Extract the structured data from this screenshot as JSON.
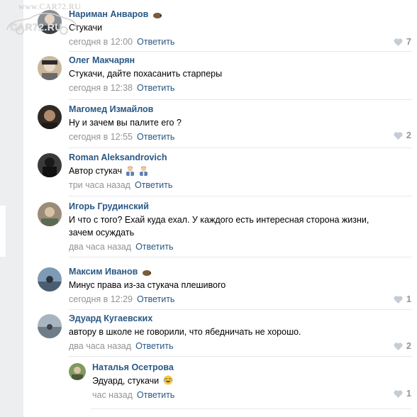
{
  "watermark": {
    "top": "www.CAR72.RU",
    "main": "CAR72.RU"
  },
  "comments": [
    {
      "author": "Нариман Анваров",
      "text": "Стукачи",
      "date": "сегодня в 12:00",
      "reply": "Ответить",
      "likes": "7",
      "badge": "hedgehog-icon"
    },
    {
      "author": "Олег Макчарян",
      "text": "Стукачи, дайте похасанить старперы",
      "date": "сегодня в 12:38",
      "reply": "Ответить",
      "likes": ""
    },
    {
      "author": "Магомед Измайлов",
      "text": "Ну и зачем вы палите его ?",
      "date": "сегодня в 12:55",
      "reply": "Ответить",
      "likes": "2"
    },
    {
      "author": "Roman Aleksandrovich",
      "text": "Автор стукач",
      "date": "три часа назад",
      "reply": "Ответить",
      "likes": "",
      "emoji": [
        "man-office-worker-emoji",
        "man-office-worker-emoji"
      ]
    },
    {
      "author": "Игорь Грудинский",
      "text_line1": "И что с того? Ехай куда ехал. У каждого есть интересная сторона жизни,",
      "text_line2": "зачем осуждать",
      "date": "два часа назад",
      "reply": "Ответить",
      "likes": ""
    },
    {
      "author": "Максим Иванов",
      "text": "Минус права из-за стукача плешивого",
      "date": "сегодня в 12:29",
      "reply": "Ответить",
      "likes": "1",
      "badge": "hedgehog-icon"
    },
    {
      "author": "Эдуард Кугаевских",
      "text": "автору в школе не говорили, что ябедничать не хорошо.",
      "date": "два часа назад",
      "reply": "Ответить",
      "likes": "2"
    },
    {
      "author": "Наталья Осетрова",
      "text": "Эдуард, стукачи",
      "date": "час назад",
      "reply": "Ответить",
      "likes": "1",
      "emoji": [
        "tears-of-joy-emoji"
      ]
    }
  ],
  "colors": {
    "author": "#2a5885",
    "meta": "#939393",
    "background": "#edeef0"
  }
}
